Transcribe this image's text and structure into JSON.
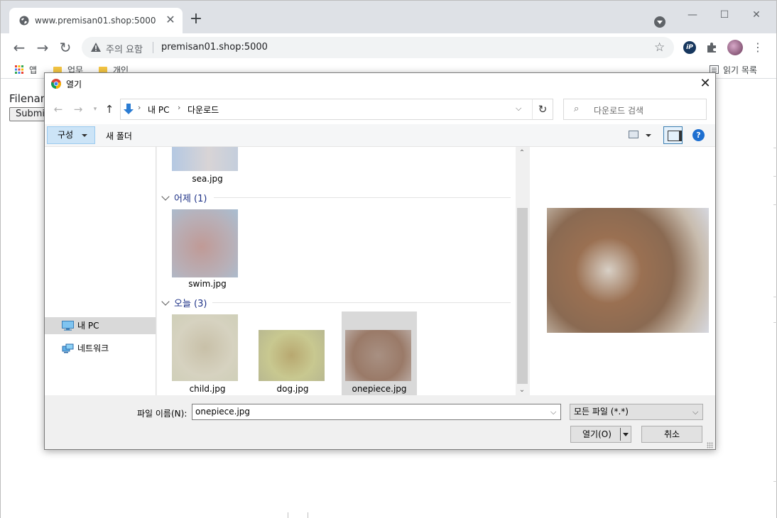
{
  "browser": {
    "tab_title": "www.premisan01.shop:5000",
    "tab_close": "✕",
    "new_tab": "+",
    "window_controls": {
      "minimize": "—",
      "maximize": "☐",
      "close": "✕"
    },
    "nav": {
      "back": "←",
      "forward": "→",
      "reload": "↻"
    },
    "security_warning": "주의 요함",
    "url": "premisan01.shop:5000",
    "star": "☆",
    "bookmarks": [
      {
        "label": "앱"
      },
      {
        "label": "업무"
      },
      {
        "label": "개인"
      }
    ],
    "reading_list": "읽기 목록",
    "menu": "⋮",
    "extension_ip_label": "iP"
  },
  "page": {
    "filename_label": "Filenam",
    "submit_label": "Submit"
  },
  "dialog": {
    "title": "열기",
    "close": "✕",
    "breadcrumb": [
      "내 PC",
      "다운로드"
    ],
    "search_placeholder": "다운로드 검색",
    "organize_label": "구성",
    "new_folder_label": "새 폴더",
    "help_label": "?",
    "nav_items": [
      {
        "label": "내 PC",
        "selected": true
      },
      {
        "label": "네트워크",
        "selected": false
      }
    ],
    "groups": [
      {
        "header": "어제 (1)"
      },
      {
        "header": "오늘 (3)"
      }
    ],
    "files": {
      "top": "sea.jpg",
      "yesterday": [
        "swim.jpg"
      ],
      "today": [
        "child.jpg",
        "dog.jpg",
        "onepiece.jpg"
      ]
    },
    "selected_file": "onepiece.jpg",
    "filename_label": "파일 이름(N):",
    "filename_value": "onepiece.jpg",
    "filetype_value": "모든 파일 (*.*)",
    "open_label": "열기(O)",
    "cancel_label": "취소",
    "colors": {
      "accent_blue": "#1e3287",
      "selection_gray": "#d9d9d9",
      "organize_bg": "#cce4f7"
    }
  }
}
